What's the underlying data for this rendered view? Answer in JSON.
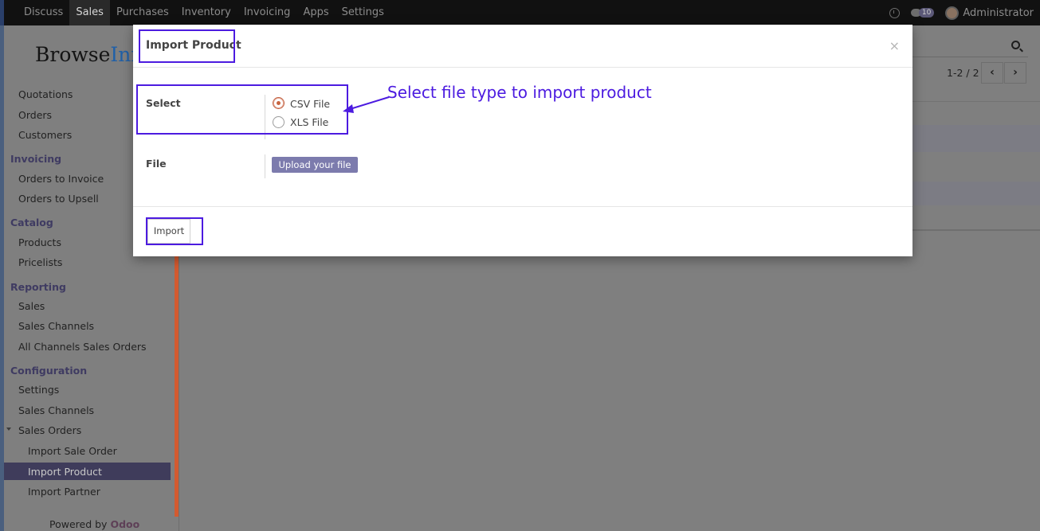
{
  "topbar": {
    "menu": [
      "Discuss",
      "Sales",
      "Purchases",
      "Inventory",
      "Invoicing",
      "Apps",
      "Settings"
    ],
    "active": "Sales",
    "message_count": "10",
    "user": "Administrator"
  },
  "sidebar": {
    "logo_dark": "Browse",
    "logo_blue": "Inf",
    "sales_items": [
      "Quotations",
      "Orders",
      "Customers"
    ],
    "invoicing": {
      "title": "Invoicing",
      "items": [
        "Orders to Invoice",
        "Orders to Upsell"
      ]
    },
    "catalog": {
      "title": "Catalog",
      "items": [
        "Products",
        "Pricelists"
      ]
    },
    "reporting": {
      "title": "Reporting",
      "items": [
        "Sales",
        "Sales Channels",
        "All Channels Sales Orders"
      ]
    },
    "configuration": {
      "title": "Configuration",
      "items": [
        "Settings",
        "Sales Channels",
        "Sales Orders"
      ]
    },
    "sales_orders_sub": [
      "Import Sale Order",
      "Import Product",
      "Import Partner"
    ],
    "active_item": "Import Product",
    "powered_by": "Powered by",
    "odoo": "Odoo"
  },
  "pager": {
    "text": "1-2 / 2",
    "prev": "‹",
    "next": "›"
  },
  "modal": {
    "title": "Import Product",
    "close": "×",
    "select_label": "Select",
    "options": [
      "CSV File",
      "XLS File"
    ],
    "selected_option": "CSV File",
    "file_label": "File",
    "upload_button": "Upload your file",
    "import_button": "Import"
  },
  "annotation": {
    "text": "Select file type to import product"
  },
  "colors": {
    "highlight": "#4c1be0",
    "brand_purple": "#7c7bad",
    "radio_accent": "#c8643f",
    "odoo_accent": "#d35a30"
  }
}
